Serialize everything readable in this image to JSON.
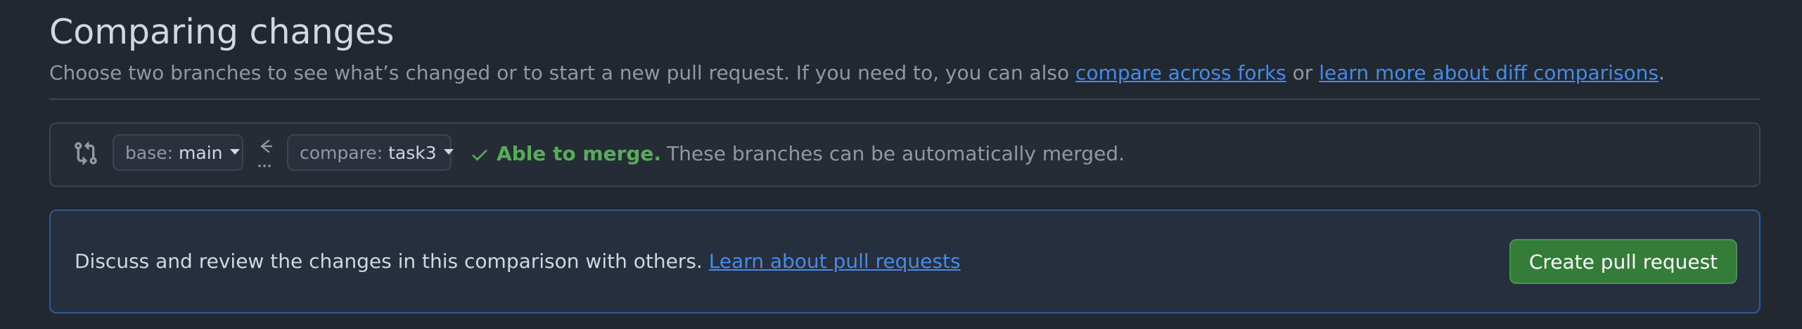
{
  "header": {
    "title": "Comparing changes",
    "description_prefix": "Choose two branches to see what’s changed or to start a new pull request. If you need to, you can also ",
    "link_compare_forks": "compare across forks",
    "description_or": " or ",
    "link_learn_diff": "learn more about diff comparisons",
    "description_suffix": "."
  },
  "range": {
    "base_label": "base:",
    "base_branch": "main",
    "compare_label": "compare:",
    "compare_branch": "task3",
    "merge_ok": "Able to merge.",
    "merge_msg": "These branches can be automatically merged."
  },
  "discuss": {
    "text": "Discuss and review the changes in this comparison with others. ",
    "link": "Learn about pull requests",
    "button": "Create pull request"
  },
  "colors": {
    "background": "#212830",
    "link": "#478be6",
    "success": "#57ab5a",
    "primary_button": "#347d39"
  },
  "icons": {
    "compare": "git-compare-icon",
    "arrow": "arrow-left-icon",
    "check": "check-icon",
    "caret": "caret-down-icon"
  }
}
